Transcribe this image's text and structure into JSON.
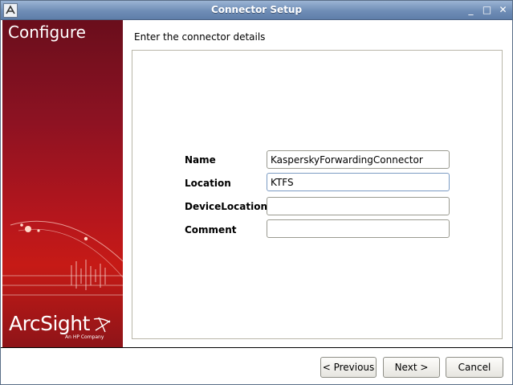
{
  "window": {
    "title": "Connector Setup",
    "controls": {
      "minimize": "_",
      "maximize": "□",
      "close": "✕"
    }
  },
  "banner": {
    "title": "Configure",
    "logo": "ArcSight",
    "tagline": "An HP Company"
  },
  "form": {
    "header": "Enter the connector details",
    "fields": [
      {
        "label": "Name",
        "value": "KasperskyForwardingConnector"
      },
      {
        "label": "Location",
        "value": "KTFS"
      },
      {
        "label": "DeviceLocation",
        "value": ""
      },
      {
        "label": "Comment",
        "value": ""
      }
    ]
  },
  "buttons": {
    "previous": "< Previous",
    "next": "Next >",
    "cancel": "Cancel"
  },
  "colors": {
    "titlebar": "#6f8db6",
    "banner_red": "#c61a16",
    "banner_dark": "#6a0e1c"
  },
  "icons": {
    "app": "arcsight-app-icon",
    "minimize": "minimize-icon",
    "maximize": "maximize-icon",
    "close": "close-icon"
  }
}
